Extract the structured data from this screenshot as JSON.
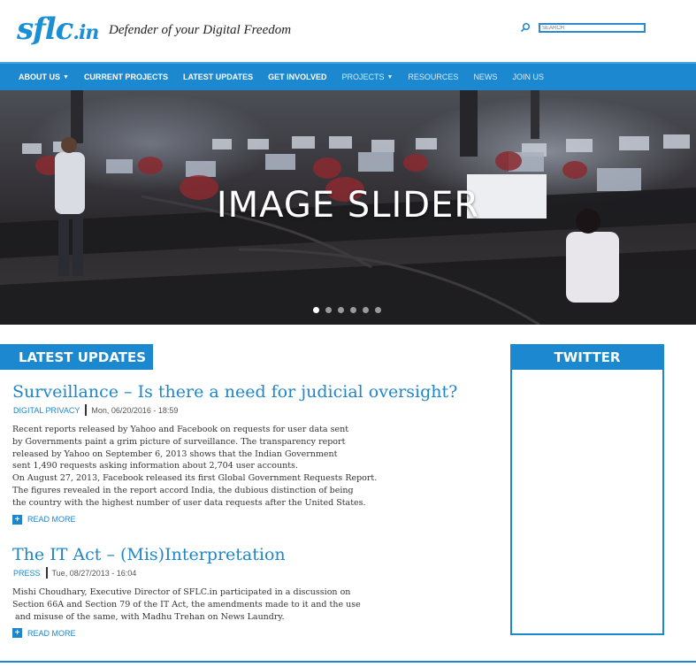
{
  "header": {
    "logo_main": "sflc",
    "logo_suffix": ".in",
    "tagline": "Defender of your Digital Freedom",
    "search_placeholder": "SEARCH"
  },
  "nav": {
    "items": [
      {
        "label": "ABOUT US",
        "dropdown": true
      },
      {
        "label": "CURRENT PROJECTS",
        "dropdown": false
      },
      {
        "label": "LATEST UPDATES",
        "dropdown": false
      },
      {
        "label": "GET INVOLVED",
        "dropdown": false
      },
      {
        "label": "PROJECTS",
        "dropdown": true
      },
      {
        "label": "RESOURCES",
        "dropdown": false
      },
      {
        "label": "NEWS",
        "dropdown": false
      },
      {
        "label": "JOIN US",
        "dropdown": false
      }
    ]
  },
  "slider": {
    "title": "IMAGE SLIDER",
    "slide_count": 6,
    "active_slide": 1
  },
  "latest": {
    "heading": "LATEST UPDATES",
    "articles": [
      {
        "title": "Surveillance – Is there a need for judicial oversight?",
        "category": "DIGITAL PRIVACY",
        "date": "Mon, 06/20/2016 - 18:59",
        "lines": [
          "Recent reports released by Yahoo and Facebook on requests for user data sent",
          "by Governments paint a grim picture of surveillance. The transparency report",
          "released by Yahoo on September 6, 2013 shows that the Indian Government",
          "sent 1,490 requests asking information about 2,704 user accounts.",
          "On August 27, 2013, Facebook released its first Global Government Requests Report.",
          "The figures revealed in the report accord India, the dubious distinction of being",
          "the country with the highest number of user data requests after the United States."
        ],
        "more": "READ MORE"
      },
      {
        "title": "The IT Act – (Mis)Interpretation",
        "category": "PRESS",
        "date": "Tue, 08/27/2013 - 16:04",
        "lines": [
          "Mishi Choudhary, Executive Director of SFLC.in participated in a discussion on",
          "Section 66A and Section 79 of the IT Act, the amendments made to it and the use",
          " and misuse of the same, with Madhu Trehan on News Laundry."
        ],
        "more": "READ MORE"
      }
    ]
  },
  "twitter": {
    "heading": "TWITTER"
  },
  "colors": {
    "brand_blue": "#1c88d0",
    "link_blue": "#1f86c9"
  }
}
